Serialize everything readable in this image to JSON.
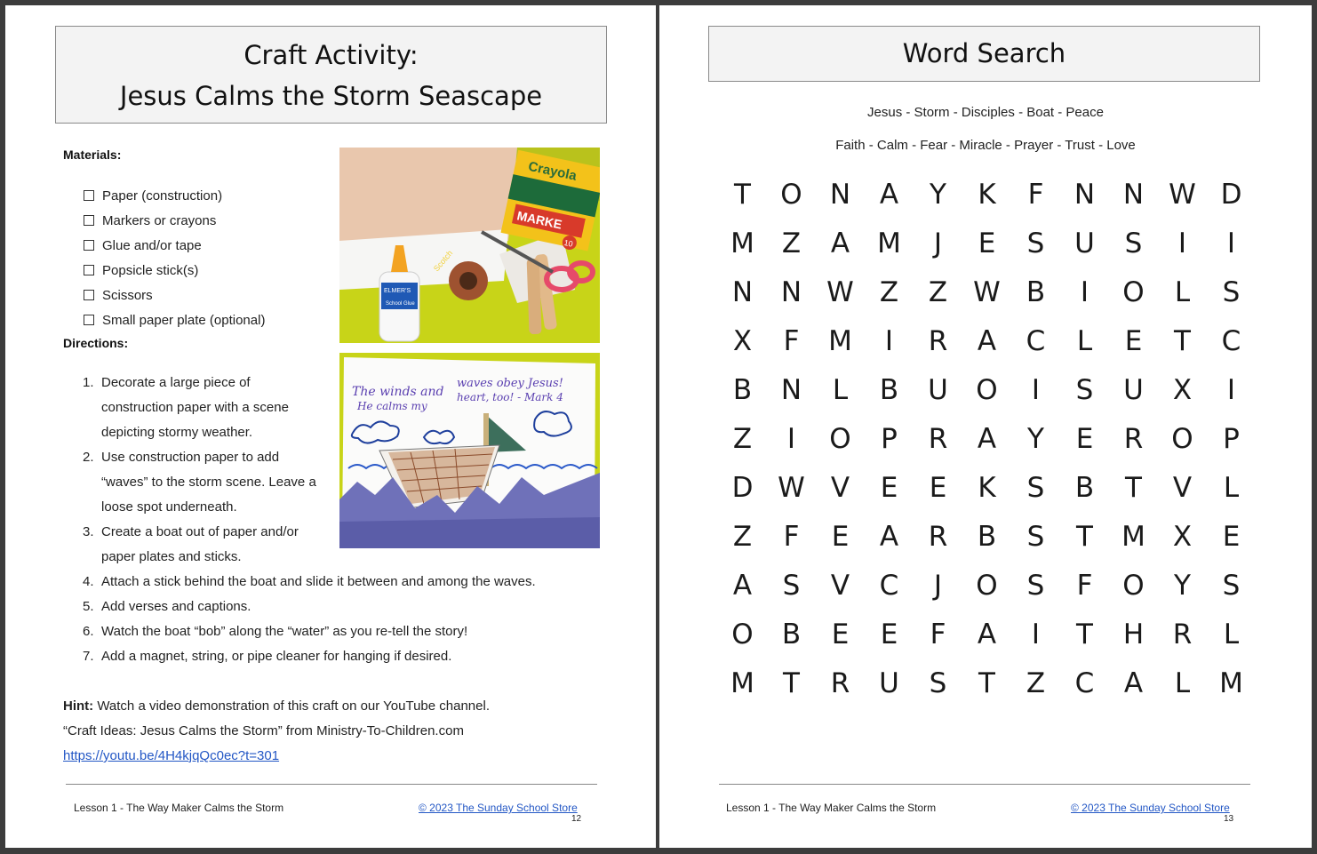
{
  "left_page": {
    "title_line1": "Craft Activity:",
    "title_line2": "Jesus Calms the Storm Seascape",
    "materials_label": "Materials:",
    "materials": [
      "Paper (construction)",
      "Markers or crayons",
      "Glue and/or tape",
      "Popsicle stick(s)",
      "Scissors",
      "Small paper plate (optional)"
    ],
    "directions_label": "Directions:",
    "directions": [
      {
        "num": "1.",
        "lines": [
          "Decorate a large piece of",
          "construction paper with a scene",
          "depicting stormy weather."
        ]
      },
      {
        "num": "2.",
        "lines": [
          "Use construction paper to add",
          "“waves” to the storm scene. Leave a",
          "loose spot underneath."
        ]
      },
      {
        "num": "3.",
        "lines": [
          "Create a boat out of paper and/or",
          "paper plates and sticks."
        ]
      },
      {
        "num": "4.",
        "lines": [
          "Attach a stick behind the boat and slide it between and among the waves."
        ]
      },
      {
        "num": "5.",
        "lines": [
          "Add verses and captions."
        ]
      },
      {
        "num": "6.",
        "lines": [
          "Watch the boat “bob” along the “water” as you re-tell the story!"
        ]
      },
      {
        "num": "7.",
        "lines": [
          "Add a magnet, string, or pipe cleaner for hanging if desired."
        ]
      }
    ],
    "hint_label": "Hint:",
    "hint_text": " Watch a video demonstration of this craft on our YouTube channel.",
    "hint_line2": "“Craft Ideas: Jesus Calms the Storm” from Ministry-To-Children.com",
    "hint_link": "https://youtu.be/4H4kjqQc0ec?t=301",
    "photo_supplies": {
      "crayola": "Crayola",
      "marker": "MARKE",
      "marker_count": "10",
      "glue_brand": "ELMER'S",
      "glue_label": "School Glue",
      "tape_brand": "Scotch"
    },
    "photo_seascape": {
      "line1a": "The winds and",
      "line1b": "waves obey Jesus!",
      "line2a": "He calms my",
      "line2b": "heart, too! - Mark 4"
    },
    "footer_left": "Lesson 1 - The Way Maker Calms the Storm",
    "footer_right": "© 2023 The Sunday School Store",
    "page_number": "12"
  },
  "right_page": {
    "title": "Word Search",
    "words_line1": "Jesus - Storm - Disciples - Boat - Peace",
    "words_line2": "Faith - Calm - Fear - Miracle - Prayer - Trust - Love",
    "grid": [
      [
        "T",
        "O",
        "N",
        "A",
        "Y",
        "K",
        "F",
        "N",
        "N",
        "W",
        "D"
      ],
      [
        "M",
        "Z",
        "A",
        "M",
        "J",
        "E",
        "S",
        "U",
        "S",
        "I",
        "I"
      ],
      [
        "N",
        "N",
        "W",
        "Z",
        "Z",
        "W",
        "B",
        "I",
        "O",
        "L",
        "S"
      ],
      [
        "X",
        "F",
        "M",
        "I",
        "R",
        "A",
        "C",
        "L",
        "E",
        "T",
        "C"
      ],
      [
        "B",
        "N",
        "L",
        "B",
        "U",
        "O",
        "I",
        "S",
        "U",
        "X",
        "I"
      ],
      [
        "Z",
        "I",
        "O",
        "P",
        "R",
        "A",
        "Y",
        "E",
        "R",
        "O",
        "P"
      ],
      [
        "D",
        "W",
        "V",
        "E",
        "E",
        "K",
        "S",
        "B",
        "T",
        "V",
        "L"
      ],
      [
        "Z",
        "F",
        "E",
        "A",
        "R",
        "B",
        "S",
        "T",
        "M",
        "X",
        "E"
      ],
      [
        "A",
        "S",
        "V",
        "C",
        "J",
        "O",
        "S",
        "F",
        "O",
        "Y",
        "S"
      ],
      [
        "O",
        "B",
        "E",
        "E",
        "F",
        "A",
        "I",
        "T",
        "H",
        "R",
        "L"
      ],
      [
        "M",
        "T",
        "R",
        "U",
        "S",
        "T",
        "Z",
        "C",
        "A",
        "L",
        "M"
      ]
    ],
    "footer_left": "Lesson 1 - The Way Maker Calms the Storm",
    "footer_right": "© 2023 The Sunday School Store",
    "page_number": "13"
  }
}
